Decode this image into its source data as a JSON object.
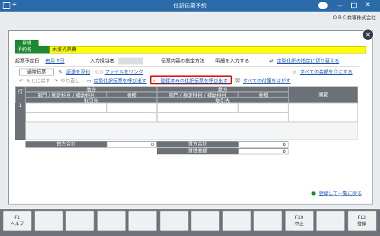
{
  "window": {
    "title": "仕訳伝票予約",
    "company": "ＯＢＣ商事株式会社"
  },
  "header": {
    "badge": "新規",
    "name_label": "予約名",
    "name_value": "水道光熱費"
  },
  "row2": {
    "schedule_label": "起票予定日",
    "schedule_value": "毎月 5日",
    "person_label": "入力担当者",
    "spec_label": "伝票内容の指定方法",
    "spec_value": "明細を入力する",
    "switch_link": "定型仕訳の指定に切り替える"
  },
  "toolbar": {
    "tab_normal": "通常伝票",
    "attach": "証憑を添付",
    "file_link": "ファイルをリンク",
    "clear_all": "すべての金額を０にする",
    "undo": "もとに戻す",
    "redo": "やり直し",
    "call_template": "定型仕訳伝票を呼び出す",
    "call_registered": "登録済みの仕訳伝票を呼び出す",
    "remove_tags": "すべての付箋をはがす"
  },
  "grid": {
    "row_header": "行",
    "debit": "借方",
    "credit": "貸方",
    "dept_acct": "部門 / 勘定科目 / 補助科目",
    "amount": "金額",
    "partner": "取引先",
    "memo": "摘要",
    "row_no": "1"
  },
  "totals": {
    "debit_total": "借方合計",
    "debit_value": "0",
    "credit_total": "貸方合計",
    "credit_value": "0",
    "diff": "貸借差額",
    "diff_value": "0"
  },
  "footer": {
    "back_link": "登録して一覧に戻る"
  },
  "fkeys": [
    {
      "key": "F1",
      "label": "ヘルプ"
    },
    {
      "key": "",
      "label": ""
    },
    {
      "key": "",
      "label": ""
    },
    {
      "key": "",
      "label": ""
    },
    {
      "key": "",
      "label": ""
    },
    {
      "key": "",
      "label": ""
    },
    {
      "key": "",
      "label": ""
    },
    {
      "key": "",
      "label": ""
    },
    {
      "key": "",
      "label": ""
    },
    {
      "key": "F10",
      "label": "中止"
    },
    {
      "key": "",
      "label": ""
    },
    {
      "key": "F12",
      "label": "登録"
    }
  ]
}
